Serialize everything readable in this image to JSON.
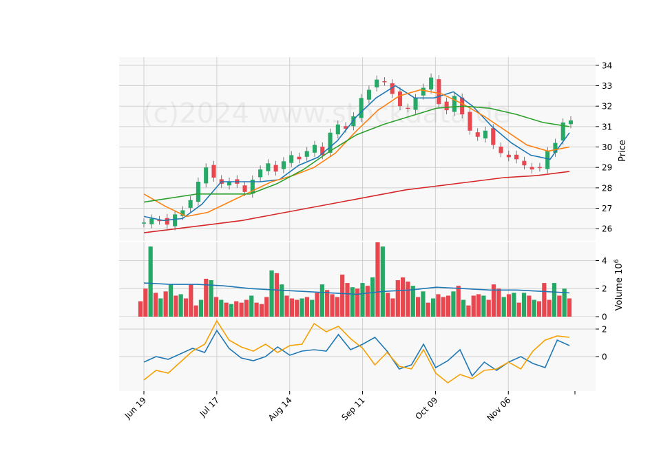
{
  "watermark": "(c)2024 www.stockdata.de",
  "chart_data": {
    "type": "candlestick",
    "x_tick_labels": [
      "Jun 19",
      "Jul 17",
      "Aug 14",
      "Sep 11",
      "Oct 09",
      "Nov 06"
    ],
    "x_tick_dates": [
      "2023-06-19",
      "2023-07-17",
      "2023-08-14",
      "2023-09-11",
      "2023-10-09",
      "2023-11-06"
    ],
    "date_range": [
      "2023-06-19",
      "2023-11-30"
    ],
    "grid": true,
    "panels": [
      {
        "name": "price",
        "ylabel": "Price",
        "ylim": [
          25.4,
          34.4
        ],
        "yticks": [
          26,
          27,
          28,
          29,
          30,
          31,
          32,
          33,
          34
        ],
        "candles_close": [
          26.3,
          26.5,
          26.4,
          26.2,
          26.7,
          26.9,
          27.4,
          28.3,
          29.0,
          28.5,
          28.2,
          28.3,
          28.2,
          27.8,
          28.4,
          28.9,
          29.2,
          28.8,
          29.3,
          29.6,
          29.4,
          29.8,
          30.1,
          29.6,
          30.7,
          31.1,
          30.9,
          31.5,
          32.4,
          32.8,
          33.3,
          33.2,
          32.6,
          32.0,
          31.9,
          32.4,
          32.9,
          33.4,
          32.1,
          31.8,
          32.5,
          31.6,
          30.8,
          30.5,
          30.8,
          30.1,
          29.7,
          29.5,
          29.4,
          29.1,
          28.9,
          29.0,
          29.8,
          30.2,
          31.2,
          31.3
        ],
        "candle_colors": {
          "up": "#26a966",
          "down": "#e8474f"
        },
        "moving_averages": [
          {
            "color": "#1f77b4",
            "values": [
              26.6,
              26.4,
              26.5,
              27.2,
              28.3,
              28.3,
              28.3,
              28.4,
              29.1,
              29.5,
              30.3,
              31.5,
              32.4,
              33.0,
              32.4,
              32.4,
              32.7,
              32.0,
              31.0,
              30.2,
              29.6,
              29.4,
              30.7
            ]
          },
          {
            "color": "#ff7f0e",
            "values": [
              27.7,
              27.1,
              26.6,
              26.8,
              27.3,
              27.8,
              28.3,
              28.6,
              29.0,
              29.7,
              30.8,
              31.8,
              32.5,
              32.8,
              32.6,
              32.1,
              31.5,
              30.8,
              30.1,
              29.8,
              30.0
            ]
          },
          {
            "color": "#2ca02c",
            "values": [
              27.3,
              27.5,
              27.7,
              27.7,
              27.7,
              28.2,
              28.9,
              29.8,
              30.6,
              31.1,
              31.5,
              31.9,
              32.0,
              31.9,
              31.6,
              31.2,
              31.0
            ]
          },
          {
            "color": "#d62728",
            "values": [
              25.8,
              26.0,
              26.2,
              26.4,
              26.7,
              27.0,
              27.3,
              27.6,
              27.9,
              28.1,
              28.3,
              28.5,
              28.6,
              28.8
            ]
          }
        ]
      },
      {
        "name": "volume",
        "ylabel": "Volume  10^6",
        "ylabel_text": "Volume",
        "ylabel_exponent": "6",
        "ylim": [
          0,
          5.3
        ],
        "yticks": [
          0,
          2,
          4
        ],
        "bars": [
          1.1,
          2.0,
          5.0,
          1.7,
          1.3,
          1.8,
          2.3,
          1.5,
          1.6,
          1.3,
          2.3,
          0.8,
          1.2,
          2.7,
          2.6,
          1.4,
          1.2,
          1.0,
          0.9,
          1.1,
          1.0,
          1.2,
          1.5,
          1.0,
          0.9,
          1.4,
          3.3,
          3.1,
          2.3,
          1.5,
          1.3,
          1.2,
          1.3,
          1.4,
          1.2,
          1.7,
          2.3,
          1.9,
          1.6,
          1.4,
          3.0,
          2.4,
          2.1,
          2.0,
          2.4,
          2.2,
          2.8,
          5.3,
          5.0,
          1.7,
          1.3,
          2.6,
          2.8,
          2.5,
          2.2,
          1.4,
          1.8,
          1.0,
          1.3,
          1.6,
          1.4,
          1.5,
          1.8,
          2.2,
          1.2,
          0.8,
          1.5,
          1.6,
          1.5,
          1.2,
          2.3,
          2.0,
          1.4,
          1.6,
          1.7,
          1.0,
          1.7,
          1.5,
          1.2,
          1.1,
          2.4,
          1.2,
          2.4,
          1.5,
          2.0,
          1.3
        ],
        "bar_colors": {
          "up": "#26a966",
          "down": "#e8474f"
        },
        "average_line": {
          "color": "#1f77b4",
          "values": [
            2.4,
            2.3,
            2.3,
            2.2,
            2.0,
            1.9,
            1.8,
            1.7,
            1.6,
            1.8,
            1.9,
            2.1,
            2.0,
            1.9,
            1.9,
            1.8,
            1.7
          ]
        }
      },
      {
        "name": "oscillator",
        "ylabel": "",
        "ylim": [
          -2.5,
          2.8
        ],
        "yticks": [
          0,
          2
        ],
        "lines": [
          {
            "color": "#1f77b4",
            "values": [
              -0.4,
              0.0,
              -0.2,
              0.2,
              0.6,
              0.3,
              1.9,
              0.6,
              -0.1,
              -0.3,
              0.0,
              0.7,
              0.1,
              0.4,
              0.5,
              0.4,
              1.6,
              0.5,
              0.9,
              1.4,
              0.4,
              -0.9,
              -0.6,
              0.9,
              -0.8,
              -0.3,
              0.5,
              -1.4,
              -0.4,
              -1.0,
              -0.4,
              0.0,
              -0.5,
              -0.8,
              1.2,
              0.8
            ]
          },
          {
            "color": "#f5a000",
            "values": [
              -1.7,
              -1.0,
              -1.2,
              -0.4,
              0.4,
              0.9,
              2.6,
              1.2,
              0.7,
              0.4,
              0.9,
              0.3,
              0.8,
              0.9,
              2.4,
              1.8,
              2.2,
              1.3,
              0.6,
              -0.6,
              0.3,
              -0.7,
              -0.9,
              0.5,
              -1.2,
              -1.9,
              -1.3,
              -1.6,
              -1.0,
              -0.9,
              -0.4,
              -0.9,
              0.4,
              1.2,
              1.5,
              1.4
            ]
          }
        ]
      }
    ]
  }
}
